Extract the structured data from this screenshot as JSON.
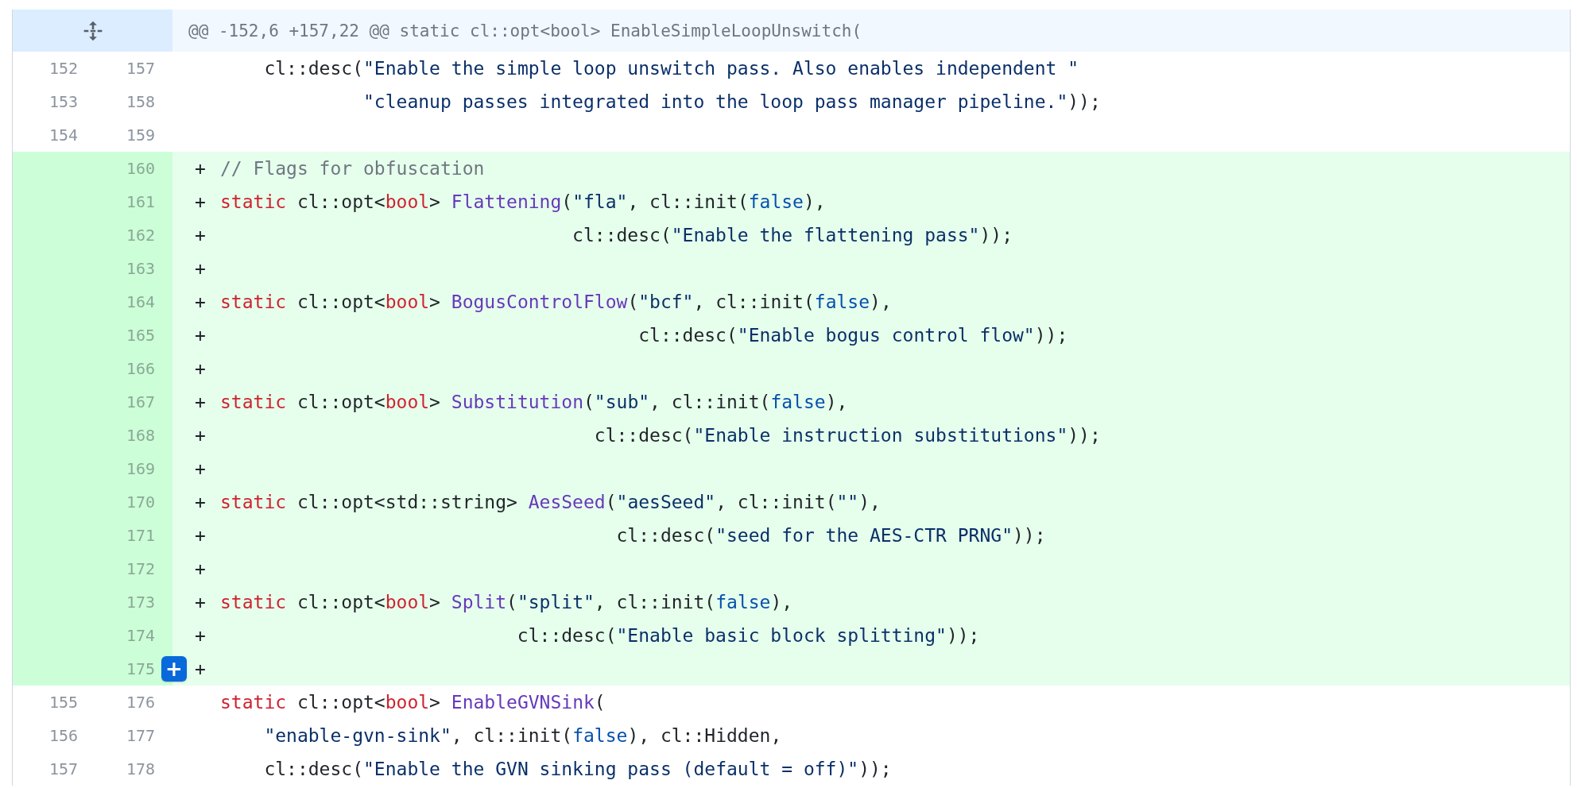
{
  "hunk": {
    "header": "@@ -152,6 +157,22 @@ static cl::opt<bool> EnableSimpleLoopUnswitch("
  },
  "lines": [
    {
      "added": false,
      "old": "152",
      "new": "157",
      "tokens": [
        {
          "kind": "plain",
          "text": "    cl::desc("
        },
        {
          "kind": "string",
          "text": "\"Enable the simple loop unswitch pass. Also enables independent \""
        }
      ]
    },
    {
      "added": false,
      "old": "153",
      "new": "158",
      "tokens": [
        {
          "kind": "string",
          "text": "             \"cleanup passes integrated into the loop pass manager pipeline.\""
        },
        {
          "kind": "plain",
          "text": "));"
        }
      ]
    },
    {
      "added": false,
      "old": "154",
      "new": "159"
    },
    {
      "added": true,
      "new": "160",
      "marker": "+",
      "tokens": [
        {
          "kind": "comment",
          "text": "// Flags for obfuscation"
        }
      ]
    },
    {
      "added": true,
      "new": "161",
      "marker": "+",
      "tokens": [
        {
          "kind": "keyword",
          "text": "static"
        },
        {
          "kind": "plain",
          "text": " cl::opt<"
        },
        {
          "kind": "keyword",
          "text": "bool"
        },
        {
          "kind": "plain",
          "text": "> "
        },
        {
          "kind": "entity",
          "text": "Flattening"
        },
        {
          "kind": "plain",
          "text": "("
        },
        {
          "kind": "string",
          "text": "\"fla\""
        },
        {
          "kind": "plain",
          "text": ", cl::init("
        },
        {
          "kind": "constant",
          "text": "false"
        },
        {
          "kind": "plain",
          "text": "),"
        }
      ]
    },
    {
      "added": true,
      "new": "162",
      "marker": "+",
      "tokens": [
        {
          "kind": "plain",
          "text": "                                cl::desc("
        },
        {
          "kind": "string",
          "text": "\"Enable the flattening pass\""
        },
        {
          "kind": "plain",
          "text": "));"
        }
      ]
    },
    {
      "added": true,
      "new": "163",
      "marker": "+"
    },
    {
      "added": true,
      "new": "164",
      "marker": "+",
      "tokens": [
        {
          "kind": "keyword",
          "text": "static"
        },
        {
          "kind": "plain",
          "text": " cl::opt<"
        },
        {
          "kind": "keyword",
          "text": "bool"
        },
        {
          "kind": "plain",
          "text": "> "
        },
        {
          "kind": "entity",
          "text": "BogusControlFlow"
        },
        {
          "kind": "plain",
          "text": "("
        },
        {
          "kind": "string",
          "text": "\"bcf\""
        },
        {
          "kind": "plain",
          "text": ", cl::init("
        },
        {
          "kind": "constant",
          "text": "false"
        },
        {
          "kind": "plain",
          "text": "),"
        }
      ]
    },
    {
      "added": true,
      "new": "165",
      "marker": "+",
      "tokens": [
        {
          "kind": "plain",
          "text": "                                      cl::desc("
        },
        {
          "kind": "string",
          "text": "\"Enable bogus control flow\""
        },
        {
          "kind": "plain",
          "text": "));"
        }
      ]
    },
    {
      "added": true,
      "new": "166",
      "marker": "+"
    },
    {
      "added": true,
      "new": "167",
      "marker": "+",
      "tokens": [
        {
          "kind": "keyword",
          "text": "static"
        },
        {
          "kind": "plain",
          "text": " cl::opt<"
        },
        {
          "kind": "keyword",
          "text": "bool"
        },
        {
          "kind": "plain",
          "text": "> "
        },
        {
          "kind": "entity",
          "text": "Substitution"
        },
        {
          "kind": "plain",
          "text": "("
        },
        {
          "kind": "string",
          "text": "\"sub\""
        },
        {
          "kind": "plain",
          "text": ", cl::init("
        },
        {
          "kind": "constant",
          "text": "false"
        },
        {
          "kind": "plain",
          "text": "),"
        }
      ]
    },
    {
      "added": true,
      "new": "168",
      "marker": "+",
      "tokens": [
        {
          "kind": "plain",
          "text": "                                  cl::desc("
        },
        {
          "kind": "string",
          "text": "\"Enable instruction substitutions\""
        },
        {
          "kind": "plain",
          "text": "));"
        }
      ]
    },
    {
      "added": true,
      "new": "169",
      "marker": "+"
    },
    {
      "added": true,
      "new": "170",
      "marker": "+",
      "tokens": [
        {
          "kind": "keyword",
          "text": "static"
        },
        {
          "kind": "plain",
          "text": " cl::opt<std::string> "
        },
        {
          "kind": "entity",
          "text": "AesSeed"
        },
        {
          "kind": "plain",
          "text": "("
        },
        {
          "kind": "string",
          "text": "\"aesSeed\""
        },
        {
          "kind": "plain",
          "text": ", cl::init("
        },
        {
          "kind": "string",
          "text": "\"\""
        },
        {
          "kind": "plain",
          "text": "),"
        }
      ]
    },
    {
      "added": true,
      "new": "171",
      "marker": "+",
      "tokens": [
        {
          "kind": "plain",
          "text": "                                    cl::desc("
        },
        {
          "kind": "string",
          "text": "\"seed for the AES-CTR PRNG\""
        },
        {
          "kind": "plain",
          "text": "));"
        }
      ]
    },
    {
      "added": true,
      "new": "172",
      "marker": "+"
    },
    {
      "added": true,
      "new": "173",
      "marker": "+",
      "tokens": [
        {
          "kind": "keyword",
          "text": "static"
        },
        {
          "kind": "plain",
          "text": " cl::opt<"
        },
        {
          "kind": "keyword",
          "text": "bool"
        },
        {
          "kind": "plain",
          "text": "> "
        },
        {
          "kind": "entity",
          "text": "Split"
        },
        {
          "kind": "plain",
          "text": "("
        },
        {
          "kind": "string",
          "text": "\"split\""
        },
        {
          "kind": "plain",
          "text": ", cl::init("
        },
        {
          "kind": "constant",
          "text": "false"
        },
        {
          "kind": "plain",
          "text": "),"
        }
      ]
    },
    {
      "added": true,
      "new": "174",
      "marker": "+",
      "tokens": [
        {
          "kind": "plain",
          "text": "                           cl::desc("
        },
        {
          "kind": "string",
          "text": "\"Enable basic block splitting\""
        },
        {
          "kind": "plain",
          "text": "));"
        }
      ]
    },
    {
      "added": true,
      "new": "175",
      "marker": "+",
      "comment_button": "+"
    },
    {
      "added": false,
      "old": "155",
      "new": "176",
      "tokens": [
        {
          "kind": "keyword",
          "text": "static"
        },
        {
          "kind": "plain",
          "text": " cl::opt<"
        },
        {
          "kind": "keyword",
          "text": "bool"
        },
        {
          "kind": "plain",
          "text": "> "
        },
        {
          "kind": "entity",
          "text": "EnableGVNSink"
        },
        {
          "kind": "plain",
          "text": "("
        }
      ]
    },
    {
      "added": false,
      "old": "156",
      "new": "177",
      "tokens": [
        {
          "kind": "string",
          "text": "    \"enable-gvn-sink\""
        },
        {
          "kind": "plain",
          "text": ", cl::init("
        },
        {
          "kind": "constant",
          "text": "false"
        },
        {
          "kind": "plain",
          "text": "), cl::Hidden,"
        }
      ]
    },
    {
      "added": false,
      "old": "157",
      "new": "178",
      "tokens": [
        {
          "kind": "plain",
          "text": "    cl::desc("
        },
        {
          "kind": "string",
          "text": "\"Enable the GVN sinking pass (default = off)\""
        },
        {
          "kind": "plain",
          "text": "));"
        }
      ]
    }
  ]
}
